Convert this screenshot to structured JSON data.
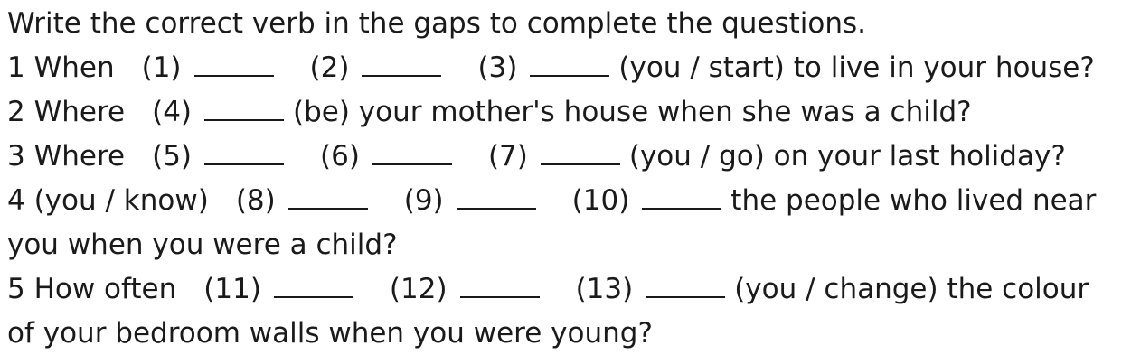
{
  "instruction": "Write the correct verb in the gaps to complete the questions.",
  "questions": [
    {
      "lead": "1 When",
      "gaps": [
        "(1)",
        "(2)",
        "(3)"
      ],
      "tail": "(you / start) to live in your house?"
    },
    {
      "lead": "2 Where",
      "gaps": [
        "(4)"
      ],
      "tail": "(be) your mother's house when she was a child?"
    },
    {
      "lead": "3 Where",
      "gaps": [
        "(5)",
        "(6)",
        "(7)"
      ],
      "tail": "(you / go) on your last holiday?"
    },
    {
      "lead": "4 (you / know)",
      "gaps": [
        "(8)",
        "(9)",
        "(10)"
      ],
      "tail": "the people who lived near",
      "tail2": "you when you were a child?"
    },
    {
      "lead": "5 How often",
      "gaps": [
        "(11)",
        "(12)",
        "(13)"
      ],
      "tail": "(you / change) the colour",
      "tail2": "of your bedroom walls when you were young?"
    }
  ]
}
